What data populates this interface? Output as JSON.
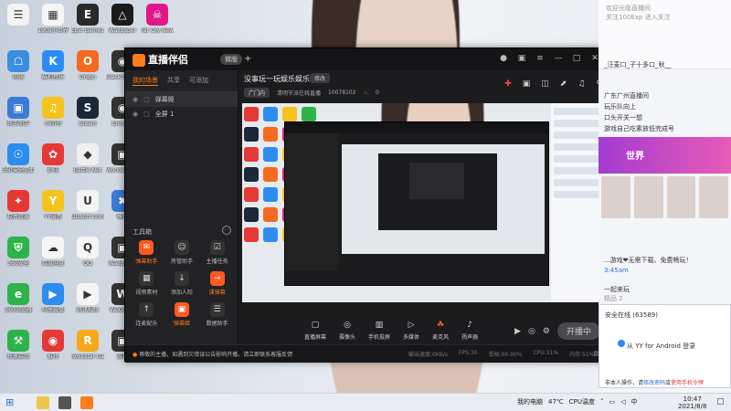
{
  "desktop": {
    "icons": [
      {
        "label": "",
        "color": "#f3f3f3",
        "glyph": "☰",
        "col": 0,
        "row": 0
      },
      {
        "label": "1908小世界",
        "color": "#f5f5f5",
        "glyph": "▦",
        "col": 1,
        "row": 0
      },
      {
        "label": "Epic Games Launcher",
        "color": "#2a2a2a",
        "glyph": "E",
        "col": 2,
        "row": 0
      },
      {
        "label": "Wallpaper",
        "color": "#1b1b1b",
        "glyph": "△",
        "col": 3,
        "row": 0
      },
      {
        "label": "Far Cry New Dawn",
        "color": "#e0188a",
        "glyph": "☠",
        "col": 4,
        "row": 0
      },
      {
        "label": "网络",
        "color": "#3b8de0",
        "glyph": "☖",
        "col": 0,
        "row": 1
      },
      {
        "label": "酷狗音乐",
        "color": "#2b8cf5",
        "glyph": "K",
        "col": 1,
        "row": 1
      },
      {
        "label": "Origin",
        "color": "#f56a1f",
        "glyph": "O",
        "col": 2,
        "row": 1
      },
      {
        "label": "Black Squad",
        "color": "#333333",
        "glyph": "◉",
        "col": 3,
        "row": 1
      },
      {
        "label": "快手助手",
        "color": "#3a7bd5",
        "glyph": "▣",
        "col": 0,
        "row": 2
      },
      {
        "label": "小问书",
        "color": "#f6c21c",
        "glyph": "♫",
        "col": 1,
        "row": 2
      },
      {
        "label": "Steam",
        "color": "#1b2838",
        "glyph": "S",
        "col": 2,
        "row": 2
      },
      {
        "label": "Chrome",
        "color": "#333333",
        "glyph": "◉",
        "col": 3,
        "row": 2
      },
      {
        "label": "360安全卫士",
        "color": "#2d8cf0",
        "glyph": "☉",
        "col": 0,
        "row": 3
      },
      {
        "label": "妙哇",
        "color": "#e53935",
        "glyph": "✿",
        "col": 1,
        "row": 3
      },
      {
        "label": "Battle Net",
        "color": "#f0f0f0",
        "glyph": "◆",
        "col": 2,
        "row": 3
      },
      {
        "label": "Wonder Launcher",
        "color": "#333333",
        "glyph": "▣",
        "col": 3,
        "row": 3
      },
      {
        "label": "软件管家",
        "color": "#e53935",
        "glyph": "✦",
        "col": 0,
        "row": 4
      },
      {
        "label": "YY语音",
        "color": "#f6c21c",
        "glyph": "Y",
        "col": 1,
        "row": 4
      },
      {
        "label": "Ubisoft Connect",
        "color": "#f4f4f4",
        "glyph": "U",
        "col": 2,
        "row": 4
      },
      {
        "label": "模拟",
        "color": "#3a7bd5",
        "glyph": "✖",
        "col": 3,
        "row": 4
      },
      {
        "label": "360安全",
        "color": "#2db34a",
        "glyph": "⛨",
        "col": 0,
        "row": 5
      },
      {
        "label": "百度网盘",
        "color": "#f5f5f5",
        "glyph": "☁",
        "col": 1,
        "row": 5
      },
      {
        "label": "QQ",
        "color": "#f5f5f5",
        "glyph": "Q",
        "col": 2,
        "row": 5
      },
      {
        "label": "Wallpaper",
        "color": "#333333",
        "glyph": "▣",
        "col": 3,
        "row": 5
      },
      {
        "label": "360浏览器",
        "color": "#2db34a",
        "glyph": "e",
        "col": 0,
        "row": 6
      },
      {
        "label": "阿里云盘",
        "color": "#2d8cf0",
        "glyph": "▶",
        "col": 1,
        "row": 6
      },
      {
        "label": "腾讯视频",
        "color": "#f5f5f5",
        "glyph": "▶",
        "col": 2,
        "row": 6
      },
      {
        "label": "WeGame",
        "color": "#333333",
        "glyph": "W",
        "col": 3,
        "row": 6
      },
      {
        "label": "快速启动",
        "color": "#2db34a",
        "glyph": "⚒",
        "col": 0,
        "row": 7
      },
      {
        "label": "推特",
        "color": "#e53935",
        "glyph": "◉",
        "col": 1,
        "row": 7
      },
      {
        "label": "Rockstar Games",
        "color": "#f6a81c",
        "glyph": "R",
        "col": 2,
        "row": 7
      },
      {
        "label": "游戏",
        "color": "#333333",
        "glyph": "▣",
        "col": 3,
        "row": 7
      }
    ]
  },
  "app": {
    "logo_text": "直播伴侣",
    "version_badge": "微版",
    "add_scene": "+",
    "titlebar_icons": [
      "avatar-icon",
      "skin-icon",
      "menu-icon",
      "minimize-icon",
      "maximize-icon",
      "close-icon"
    ],
    "tabs": [
      "我的场景",
      "共享",
      "可添加"
    ],
    "scenes": [
      {
        "label": "弹幕姬"
      },
      {
        "label": "全屏 1"
      }
    ],
    "toolbox_title": "工具箱",
    "toolbox_more": "⋯",
    "tools": [
      {
        "label": "弹幕助手",
        "glyph": "✉",
        "hot": true
      },
      {
        "label": "房管助手",
        "glyph": "☺",
        "hot": false
      },
      {
        "label": "主播任务",
        "glyph": "☑",
        "hot": false
      },
      {
        "label": "视频素材",
        "glyph": "▦",
        "hot": false
      },
      {
        "label": "添加人际",
        "glyph": "↓",
        "hot": false
      },
      {
        "label": "课弹幕",
        "glyph": "→",
        "hot": true
      },
      {
        "label": "连麦配乐",
        "glyph": "↑",
        "hot": false
      },
      {
        "label": "弹幕姬",
        "glyph": "▣",
        "hot": true
      },
      {
        "label": "数据助手",
        "glyph": "☰",
        "hot": false
      }
    ],
    "room": {
      "title": "没事玩一玩娱乐娱乐",
      "tag": "修改",
      "category": "广门内",
      "room_name": "清明节派在线直播",
      "room_id": "10078102",
      "heat": "0",
      "icons": [
        "gift-icon",
        "lock-icon",
        "camera-icon",
        "share-icon",
        "bell-icon",
        "link-icon"
      ]
    },
    "bottom_tools": [
      {
        "label": "直播屏幕",
        "glyph": "▢"
      },
      {
        "label": "摄像头",
        "glyph": "◎"
      },
      {
        "label": "手机投屏",
        "glyph": "▥"
      },
      {
        "label": "多媒体",
        "glyph": "▷"
      },
      {
        "label": "麦克风",
        "glyph": "☘",
        "red": true
      },
      {
        "label": "扬声器",
        "glyph": "♪"
      }
    ],
    "start_live": "开播中",
    "status_message": "尊敬的主播，如遇到欠错误公告影响开播，请立即联系客服反馈",
    "stats": [
      "输出速度:0KB/s",
      "FPS:30",
      "丢帧:00.00%",
      "CPU:31%",
      "内存:51%"
    ]
  },
  "yy": {
    "header_line1": "欢迎光临直播间",
    "header_line2": "关注100Exp 进入关注",
    "user_name": "_汪麦口_子十多口_秋__",
    "lines": [
      "广东广州直播间",
      "玩乐队向上",
      "口头开关一想",
      "游戏自己吃素放低完成号"
    ],
    "banner": "世界",
    "msg1": "...游戏❤无需下载、免费畅玩！",
    "msg2": "3:45am",
    "msg3": "一起来玩",
    "msg4": "精品  2",
    "popup_title": "安全在线 (63589)",
    "popup_line": "从 YY for Android 登录",
    "popup_foot_pre": "非本人操作，请",
    "popup_foot_link1": "修改密码",
    "popup_foot_mid": "或",
    "popup_foot_link2": "使用手机令牌"
  },
  "taskbar": {
    "apps": [
      "file-explorer-icon",
      "counter-strike-icon",
      "live-companion-icon"
    ],
    "tray_computer": "我的电脑",
    "temp": "47℃",
    "temp_label": "CPU温度",
    "ime": "中",
    "time": "10:47",
    "date": "2021/8/8"
  }
}
